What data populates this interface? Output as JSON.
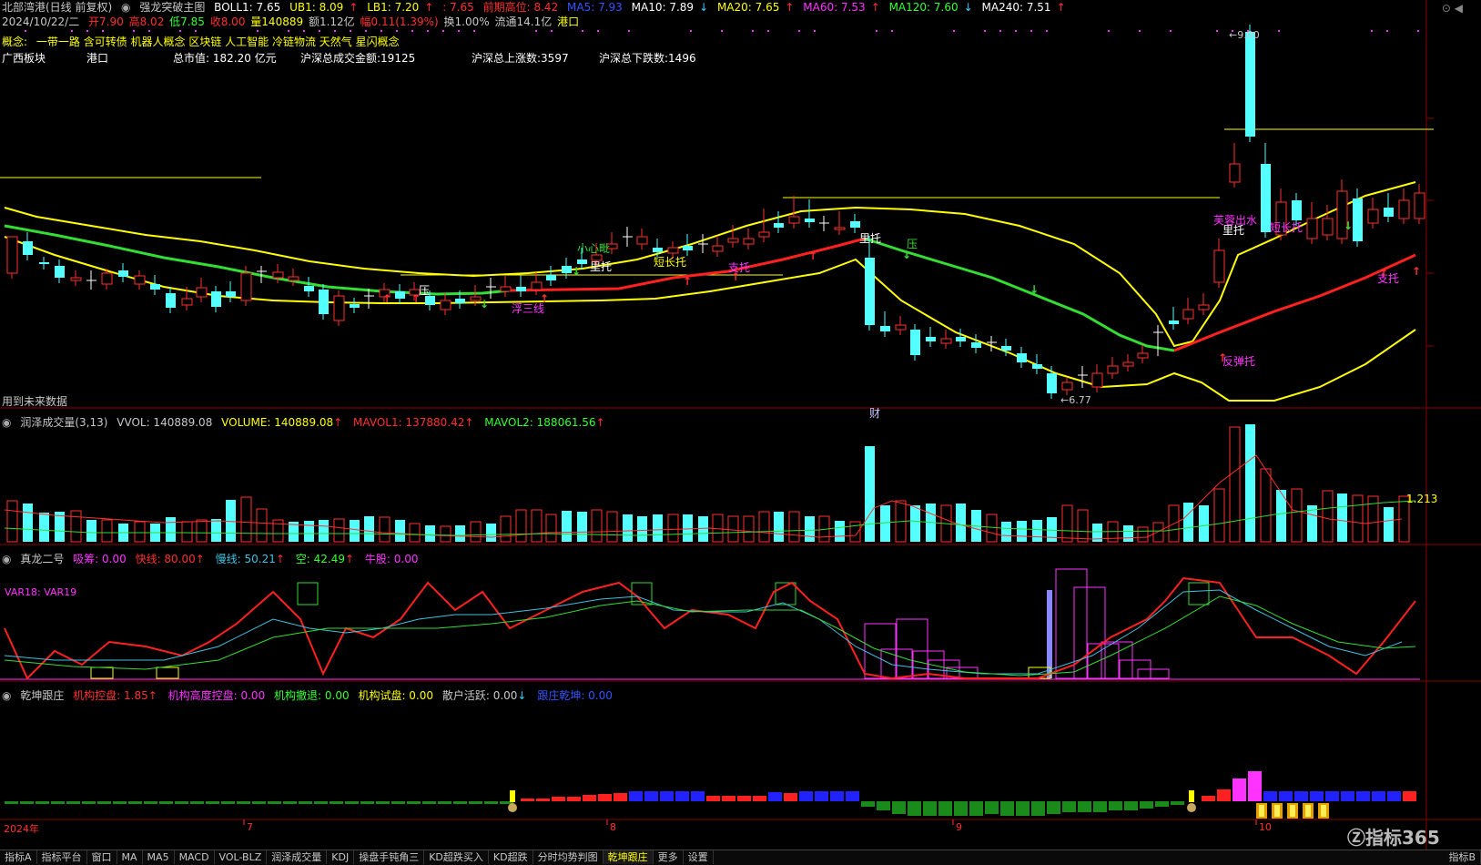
{
  "header": {
    "stock": "北部湾港(日线 前复权)",
    "indicator": "强龙突破主图",
    "boll": "BOLL1: 7.65",
    "ub": "UB1: 8.09",
    "lb": "LB1: 7.20",
    "unnamed": ": 7.65",
    "prev_high": "前期高位: 8.42",
    "ma5": "MA5: 7.93",
    "ma10": "MA10: 7.89",
    "ma20": "MA20: 7.65",
    "ma60": "MA60: 7.53",
    "ma120": "MA120: 7.60",
    "ma240": "MA240: 7.51"
  },
  "quote": {
    "date": "2024/10/22/二",
    "open": "开7.90",
    "high": "高8.02",
    "low": "低7.85",
    "close": "收8.00",
    "volume": "量140889",
    "amount": "额1.12亿",
    "change": "幅0.11(1.39%)",
    "turnover": "换1.00%",
    "float": "流通14.1亿",
    "sector": "港口"
  },
  "concepts": {
    "label": "概念:",
    "list": "一带一路 含可转债 机器人概念 区块链 人工智能 冷链物流 天然气 星闪概念"
  },
  "info": {
    "region": "广西板块",
    "industry": "港口",
    "market_cap": "总市值: 182.20 亿元",
    "total_turnover": "沪深总成交金额:19125",
    "up_count": "沪深总上涨数:3597",
    "down_count": "沪深总下跌数:1496"
  },
  "main_chart": {
    "future_note": "用到未来数据",
    "high_label": "9.00",
    "low_label": "6.77",
    "annotations": [
      "小心毗",
      "里托",
      "短长托",
      "压",
      "支托",
      "浮三线",
      "里托",
      "压",
      "里托",
      "支托",
      "芙蓉出水",
      "短长托",
      "反弹托",
      "支托",
      "财"
    ]
  },
  "volume_panel": {
    "title": "润泽成交量(3,13)",
    "vvol": "VVOL: 140889.08",
    "volume": "VOLUME: 140889.08",
    "mavol1": "MAVOL1: 137880.42",
    "mavol2": "MAVOL2: 188061.56",
    "axis_label": "1.213"
  },
  "dragon_panel": {
    "title": "真龙二号",
    "absorb": "吸筹: 0.00",
    "fast": "快线: 80.00",
    "slow": "慢线: 50.21",
    "short": "空: 42.49",
    "bull": "牛股: 0.00",
    "var": "VAR18: VAR19"
  },
  "qiankun_panel": {
    "title": "乾坤跟庄",
    "ctrl": "机构控盘: 1.85",
    "high_ctrl": "机构高度控盘: 0.00",
    "retreat": "机构撤退: 0.00",
    "test": "机构试盘: 0.00",
    "retail": "散户活跃: 0.00",
    "follow": "跟庄乾坤: 0.00"
  },
  "time_axis": {
    "labels": [
      "2024年",
      "7",
      "8",
      "9",
      "10"
    ]
  },
  "bottom_tabs": [
    "指标A",
    "指标平台",
    "窗口",
    "MA",
    "MA5",
    "MACD",
    "VOL-BLZ",
    "润泽成交量",
    "KDJ",
    "操盘手钝角三",
    "KD超跌买入",
    "KD超跌",
    "分时均势判图",
    "乾坤跟庄",
    "更多",
    "设置"
  ],
  "bottom_right": "指标B",
  "watermark": "指标365",
  "colors": {
    "up": "#ff3030",
    "down": "#54ffff",
    "ma_yellow": "#ffff00",
    "ma_green": "#33dd33",
    "boll_red": "#ff2020"
  }
}
